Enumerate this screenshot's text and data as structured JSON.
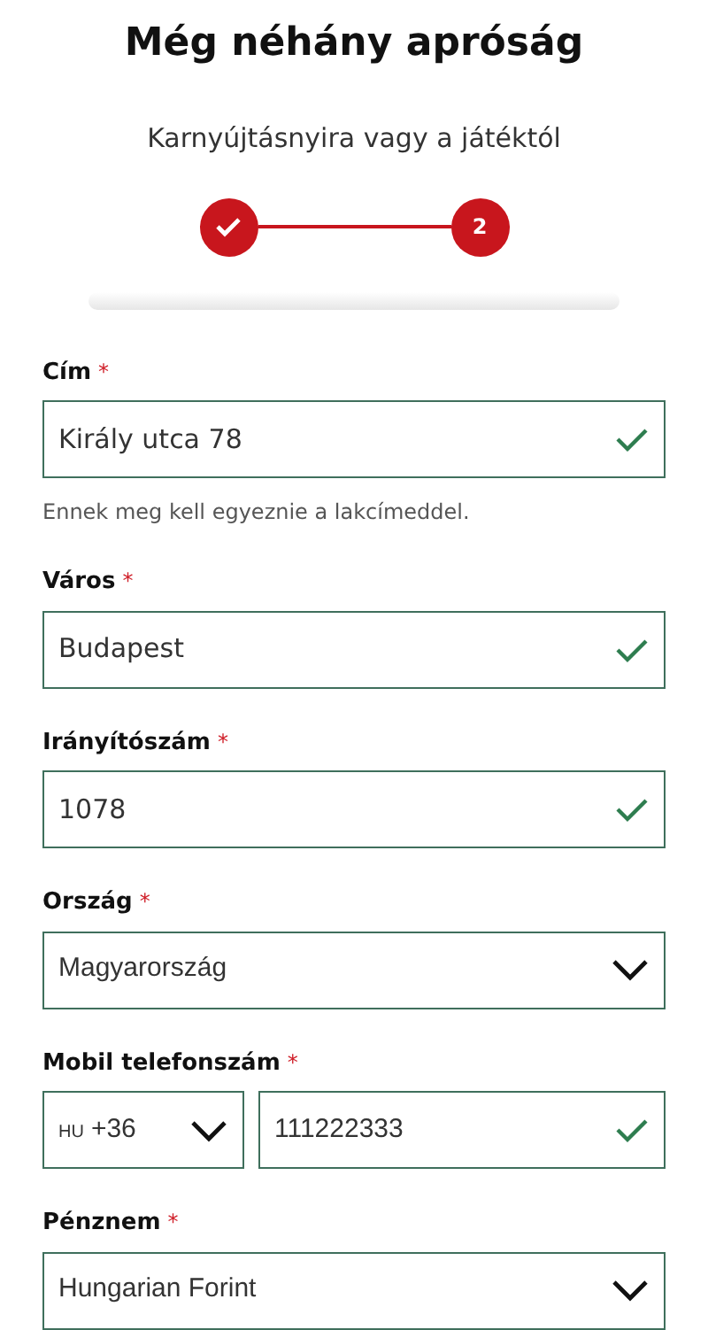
{
  "title": "Még néhány apróság",
  "subtitle": "Karnyújtásnyira vagy a játéktól",
  "steps": [
    {
      "done": true
    },
    {
      "done": false,
      "label": "2"
    }
  ],
  "fields": [
    {
      "kind": "text",
      "label": "Cím",
      "asterisk": "*",
      "value": "Király utca 78",
      "valid": true,
      "hint": "Ennek meg kell egyeznie a lakcímeddel."
    },
    {
      "kind": "text",
      "label": "Város",
      "asterisk": "*",
      "value": "Budapest",
      "valid": true
    },
    {
      "kind": "text",
      "label": "Irányítószám",
      "asterisk": "*",
      "value": "1078",
      "valid": true
    },
    {
      "kind": "select",
      "label": "Ország",
      "asterisk": "*",
      "value": "Magyarország"
    },
    {
      "kind": "phone",
      "label": "Mobil telefonszám",
      "asterisk": "*",
      "country": "HU",
      "dial_code": "+36",
      "value": "111222333",
      "valid": true
    },
    {
      "kind": "select",
      "label": "Pénznem",
      "asterisk": "*",
      "value": "Hungarian Forint"
    }
  ]
}
